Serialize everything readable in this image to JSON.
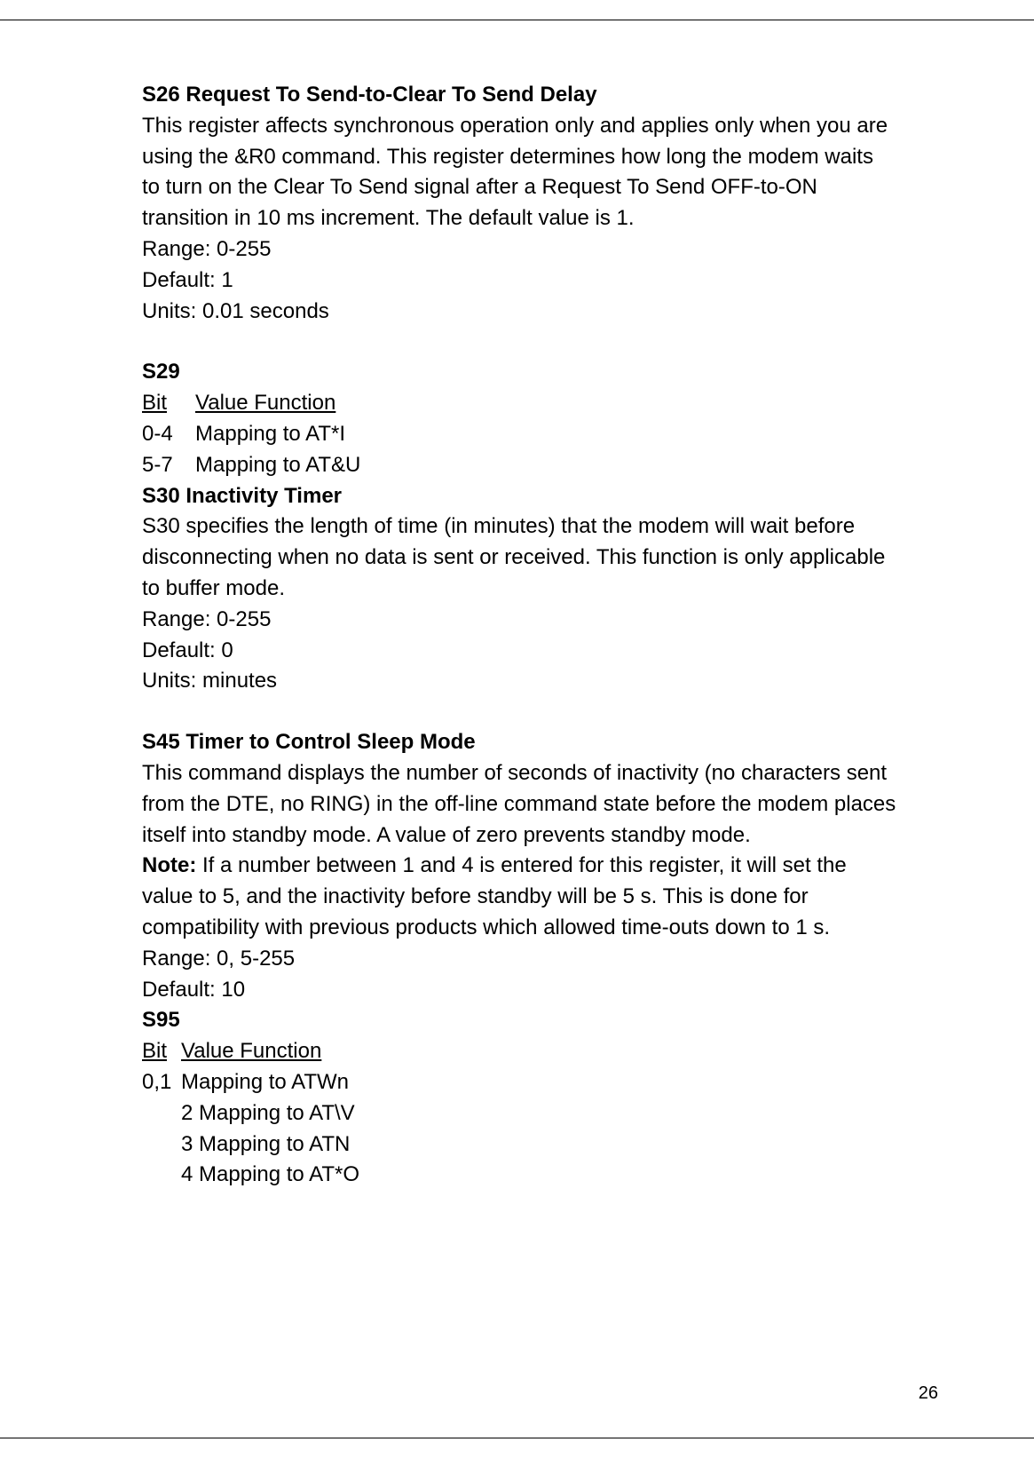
{
  "page_number": "26",
  "s26": {
    "heading": "S26 Request To Send-to-Clear To Send Delay",
    "body": "This register affects synchronous operation only and applies only when you are using the &R0 command. This register determines how long the modem waits to turn on the Clear To Send signal after a Request To Send OFF-to-ON transition in 10 ms increment. The default value is 1.",
    "range": "Range: 0-255",
    "default": "Default: 1",
    "units": "Units: 0.01 seconds"
  },
  "s29": {
    "heading": "S29",
    "col_bit": "Bit",
    "col_vf": "Value Function",
    "rows": [
      {
        "bit": "0-4",
        "vf": "Mapping to AT*I"
      },
      {
        "bit": "5-7",
        "vf": "Mapping to AT&U"
      }
    ]
  },
  "s30": {
    "heading": "S30 Inactivity Timer",
    "body": "S30 specifies the length of time (in minutes) that the modem will wait before disconnecting when no data is sent or received. This function is only applicable to buffer mode.",
    "range": "Range: 0-255",
    "default": "Default: 0",
    "units": "Units: minutes"
  },
  "s45": {
    "heading": "S45 Timer to Control Sleep Mode",
    "body": "This command displays the number of seconds of inactivity (no characters sent from the DTE, no RING) in the off-line command state before the modem places itself into standby mode. A value of zero prevents standby mode.",
    "note_label": "Note:",
    "note_body": " If a number between 1 and 4 is entered for this register, it will set the value to 5, and the inactivity before standby will be 5 s. This is done for compatibility with previous products which allowed time-outs down to 1 s.",
    "range": "Range: 0, 5-255",
    "default": "Default: 10"
  },
  "s95": {
    "heading": "S95",
    "col_bit": "Bit",
    "col_vf": "Value Function",
    "rows": [
      {
        "bit": "0,1",
        "vf": "Mapping to ATWn"
      },
      {
        "bit": "2",
        "vf": "Mapping to AT\\V"
      },
      {
        "bit": "3",
        "vf": "Mapping to ATN"
      },
      {
        "bit": "4",
        "vf": "Mapping to AT*O"
      }
    ]
  }
}
